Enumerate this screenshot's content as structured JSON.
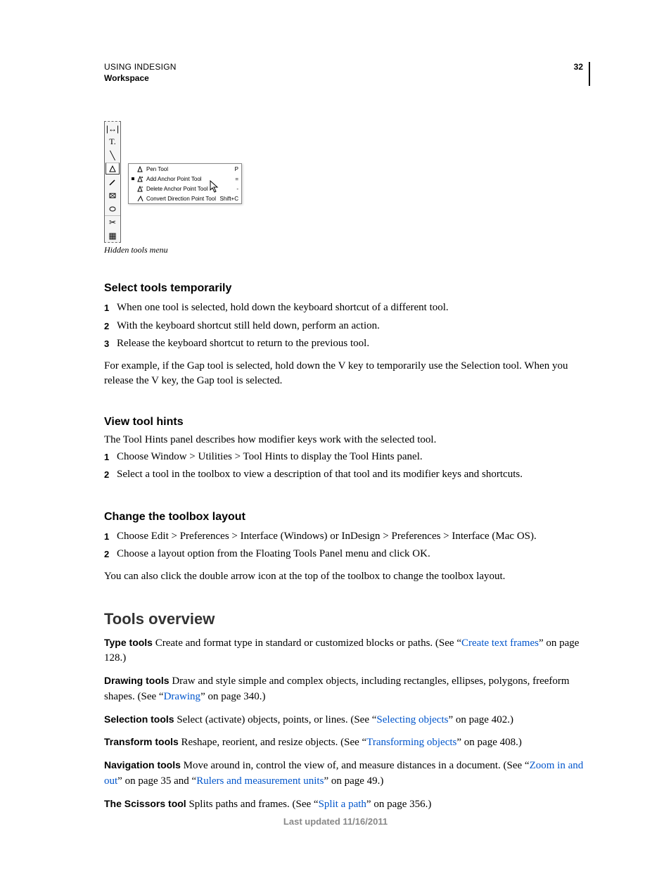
{
  "header": {
    "title": "USING INDESIGN",
    "subtitle": "Workspace",
    "page": "32"
  },
  "figure": {
    "menu": [
      {
        "label": "Pen Tool",
        "shortcut": "P",
        "selected": false
      },
      {
        "label": "Add Anchor Point Tool",
        "shortcut": "=",
        "selected": true
      },
      {
        "label": "Delete Anchor Point Tool",
        "shortcut": "-",
        "selected": false
      },
      {
        "label": "Convert Direction Point Tool",
        "shortcut": "Shift+C",
        "selected": false
      }
    ],
    "caption": "Hidden tools menu"
  },
  "s1": {
    "title": "Select tools temporarily",
    "steps": {
      "n1": "1",
      "t1": "When one tool is selected, hold down the keyboard shortcut of a different tool.",
      "n2": "2",
      "t2": "With the keyboard shortcut still held down, perform an action.",
      "n3": "3",
      "t3": "Release the keyboard shortcut to return to the previous tool."
    },
    "para": "For example, if the Gap tool is selected, hold down the V key to temporarily use the Selection tool. When you release the V key, the Gap tool is selected."
  },
  "s2": {
    "title": "View tool hints",
    "para": "The Tool Hints panel describes how modifier keys work with the selected tool.",
    "steps": {
      "n1": "1",
      "t1": "Choose Window > Utilities > Tool Hints to display the Tool Hints panel.",
      "n2": "2",
      "t2": "Select a tool in the toolbox to view a description of that tool and its modifier keys and shortcuts."
    }
  },
  "s3": {
    "title": "Change the toolbox layout",
    "steps": {
      "n1": "1",
      "t1": "Choose Edit > Preferences > Interface (Windows) or InDesign > Preferences > Interface (Mac OS).",
      "n2": "2",
      "t2": "Choose a layout option from the Floating Tools Panel menu and click OK."
    },
    "para": "You can also click the double arrow icon at the top of the toolbox to change the toolbox layout."
  },
  "overview": {
    "title": "Tools overview",
    "defs": {
      "type": {
        "lead": "Type tools",
        "pre": "  Create and format type in standard or customized blocks or paths. (See “",
        "link": "Create text frames",
        "post": "” on page 128.)"
      },
      "drawing": {
        "lead": "Drawing tools",
        "pre": "  Draw and style simple and complex objects, including rectangles, ellipses, polygons, freeform shapes. (See “",
        "link": "Drawing",
        "post": "” on page 340.)"
      },
      "selection": {
        "lead": "Selection tools",
        "pre": "  Select (activate) objects, points, or lines. (See “",
        "link": "Selecting objects",
        "post": "” on page 402.)"
      },
      "transform": {
        "lead": "Transform tools",
        "pre": "  Reshape, reorient, and resize objects. (See “",
        "link": "Transforming objects",
        "post": "” on page 408.)"
      },
      "nav": {
        "lead": "Navigation tools",
        "pre": "  Move around in, control the view of, and measure distances in a document. (See “",
        "link1": "Zoom in and out",
        "mid": "” on page 35 and “",
        "link2": "Rulers and measurement units",
        "post": "” on page 49.)"
      },
      "scissors": {
        "lead": "The Scissors tool",
        "pre": "  Splits paths and frames. (See “",
        "link": "Split a path",
        "post": "” on page 356.)"
      }
    }
  },
  "footer": "Last updated 11/16/2011"
}
